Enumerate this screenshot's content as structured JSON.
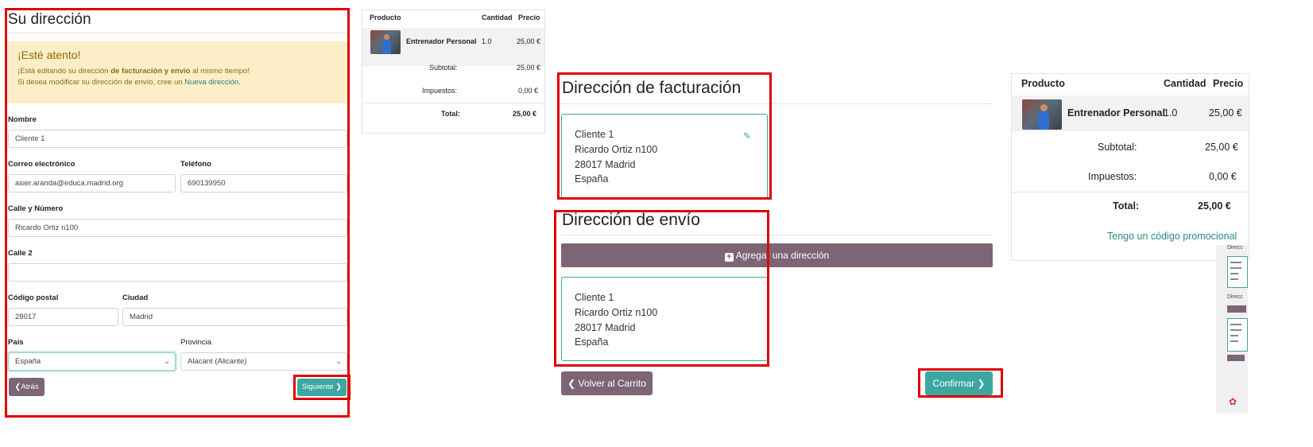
{
  "address_form": {
    "title": "Su dirección",
    "alert_title": "¡Esté atento!",
    "alert_line1_pre": "¡Está editando su dirección ",
    "alert_line1_bold": "de facturación y envío",
    "alert_line1_post": " al mismo tiempo!",
    "alert_line2_pre": "Si desea modificar su dirección de envío, cree un ",
    "alert_line2_link": "Nueva dirección",
    "alert_line2_post": ".",
    "name_label": "Nombre",
    "name_value": "Cliente 1",
    "email_label": "Correo electrónico",
    "email_value": "asier.aranda@educa.madrid.org",
    "phone_label": "Teléfono",
    "phone_value": "690139950",
    "street_label": "Calle y Número",
    "street_value": "Ricardo Ortiz n100",
    "street2_label": "Calle 2",
    "street2_value": "",
    "zip_label": "Código postal",
    "zip_value": "28017",
    "city_label": "Ciudad",
    "city_value": "Madrid",
    "country_label": "País",
    "country_value": "España",
    "province_label": "Provincia",
    "province_value": "Alacant (Alicante)",
    "back_label": "Atrás",
    "next_label": "Siguiente"
  },
  "cart_small": {
    "col_product": "Producto",
    "col_qty": "Cantidad",
    "col_price": "Precio",
    "product_name": "Entrenador Personal",
    "product_qty": "1.0",
    "product_price": "25,00 €",
    "subtotal_label": "Subtotal:",
    "subtotal_value": "25,00 €",
    "tax_label": "Impuestos:",
    "tax_value": "0,00 €",
    "total_label": "Total:",
    "total_value": "25,00 €"
  },
  "checkout": {
    "billing_title": "Dirección de facturación",
    "billing_address": [
      "Cliente 1",
      "Ricardo Ortiz n100",
      "28017 Madrid",
      "España"
    ],
    "shipping_title": "Dirección de envío",
    "add_address_label": "Agregar una dirección",
    "shipping_address": [
      "Cliente 1",
      "Ricardo Ortiz n100",
      "28017 Madrid",
      "España"
    ],
    "back_to_cart_label": "Volver al Carrito",
    "confirm_label": "Confirmar"
  },
  "cart_large": {
    "col_product": "Producto",
    "col_qty": "Cantidad",
    "col_price": "Precio",
    "product_name": "Entrenador Personal",
    "product_qty": "1.0",
    "product_price": "25,00 €",
    "subtotal_label": "Subtotal:",
    "subtotal_value": "25,00 €",
    "tax_label": "Impuestos:",
    "tax_value": "0,00 €",
    "total_label": "Total:",
    "total_value": "25,00 €",
    "promo_label": "Tengo un código promocional"
  },
  "mini_preview": {
    "heading1": "Direcc",
    "heading2": "Direcc"
  },
  "colors": {
    "primary_teal": "#3aa8a0",
    "secondary_mauve": "#7c6576",
    "highlight_red": "#e00000",
    "alert_bg": "#fcefc7"
  },
  "icons": [
    "chevron-left-icon",
    "chevron-right-icon",
    "edit-icon",
    "plus-square-icon",
    "chevron-down-icon"
  ]
}
